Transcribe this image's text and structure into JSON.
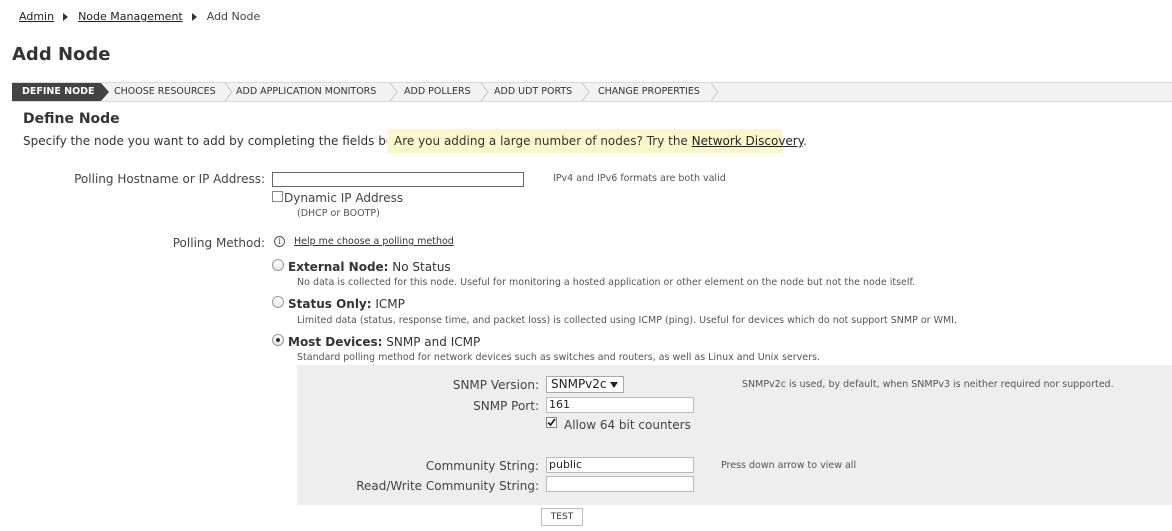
{
  "breadcrumb": {
    "admin": "Admin",
    "node_management": "Node Management",
    "current": "Add Node"
  },
  "page_title": "Add Node",
  "wizard_steps": [
    {
      "label": "DEFINE NODE"
    },
    {
      "label": "CHOOSE RESOURCES"
    },
    {
      "label": "ADD APPLICATION MONITORS"
    },
    {
      "label": "ADD POLLERS"
    },
    {
      "label": "ADD UDT PORTS"
    },
    {
      "label": "CHANGE PROPERTIES"
    }
  ],
  "section_title": "Define Node",
  "intro_text": "Specify the node you want to add by completing the fields below.",
  "hint": {
    "prefix": "Are you adding a large number of nodes? Try the ",
    "link": "Network Discovery",
    "suffix": "."
  },
  "hostname": {
    "label": "Polling Hostname or IP Address:",
    "value": "",
    "note": "IPv4 and IPv6 formats are both valid"
  },
  "dynamic_ip": {
    "label": "Dynamic IP Address",
    "sublabel": "(DHCP or BOOTP)",
    "checked": false
  },
  "polling_method": {
    "label": "Polling Method:",
    "help_link": "Help me choose a polling method",
    "options": [
      {
        "title": "External Node:",
        "subtitle": " No Status",
        "description": "No data is collected for this node. Useful for monitoring a hosted application or other element on the node but not the node itself.",
        "selected": false
      },
      {
        "title": "Status Only:",
        "subtitle": " ICMP",
        "description": "Limited data (status, response time, and packet loss) is collected using ICMP (ping). Useful for devices which do not support SNMP or WMI.",
        "selected": false
      },
      {
        "title": "Most Devices:",
        "subtitle": " SNMP and ICMP",
        "description": "Standard polling method for network devices such as switches and routers, as well as Linux and Unix servers.",
        "selected": true
      }
    ]
  },
  "snmp": {
    "version_label": "SNMP Version:",
    "version_value": "SNMPv2c",
    "version_note": "SNMPv2c is used, by default, when SNMPv3 is neither required nor supported.",
    "port_label": "SNMP Port:",
    "port_value": "161",
    "counters_label": "Allow 64 bit counters",
    "counters_checked": true,
    "community_label": "Community String:",
    "community_value": "public",
    "community_note": "Press down arrow to view all",
    "rw_label": "Read/Write Community String:",
    "rw_value": ""
  },
  "test_button": "TEST",
  "icons": {
    "breadcrumb_separator": "triangle-right",
    "info": "info-circle",
    "dropdown": "triangle-down",
    "check": "check"
  },
  "colors": {
    "active_step": "#434343",
    "hint_bg": "#fbf7c8",
    "panel_bg": "#eeeeee"
  }
}
